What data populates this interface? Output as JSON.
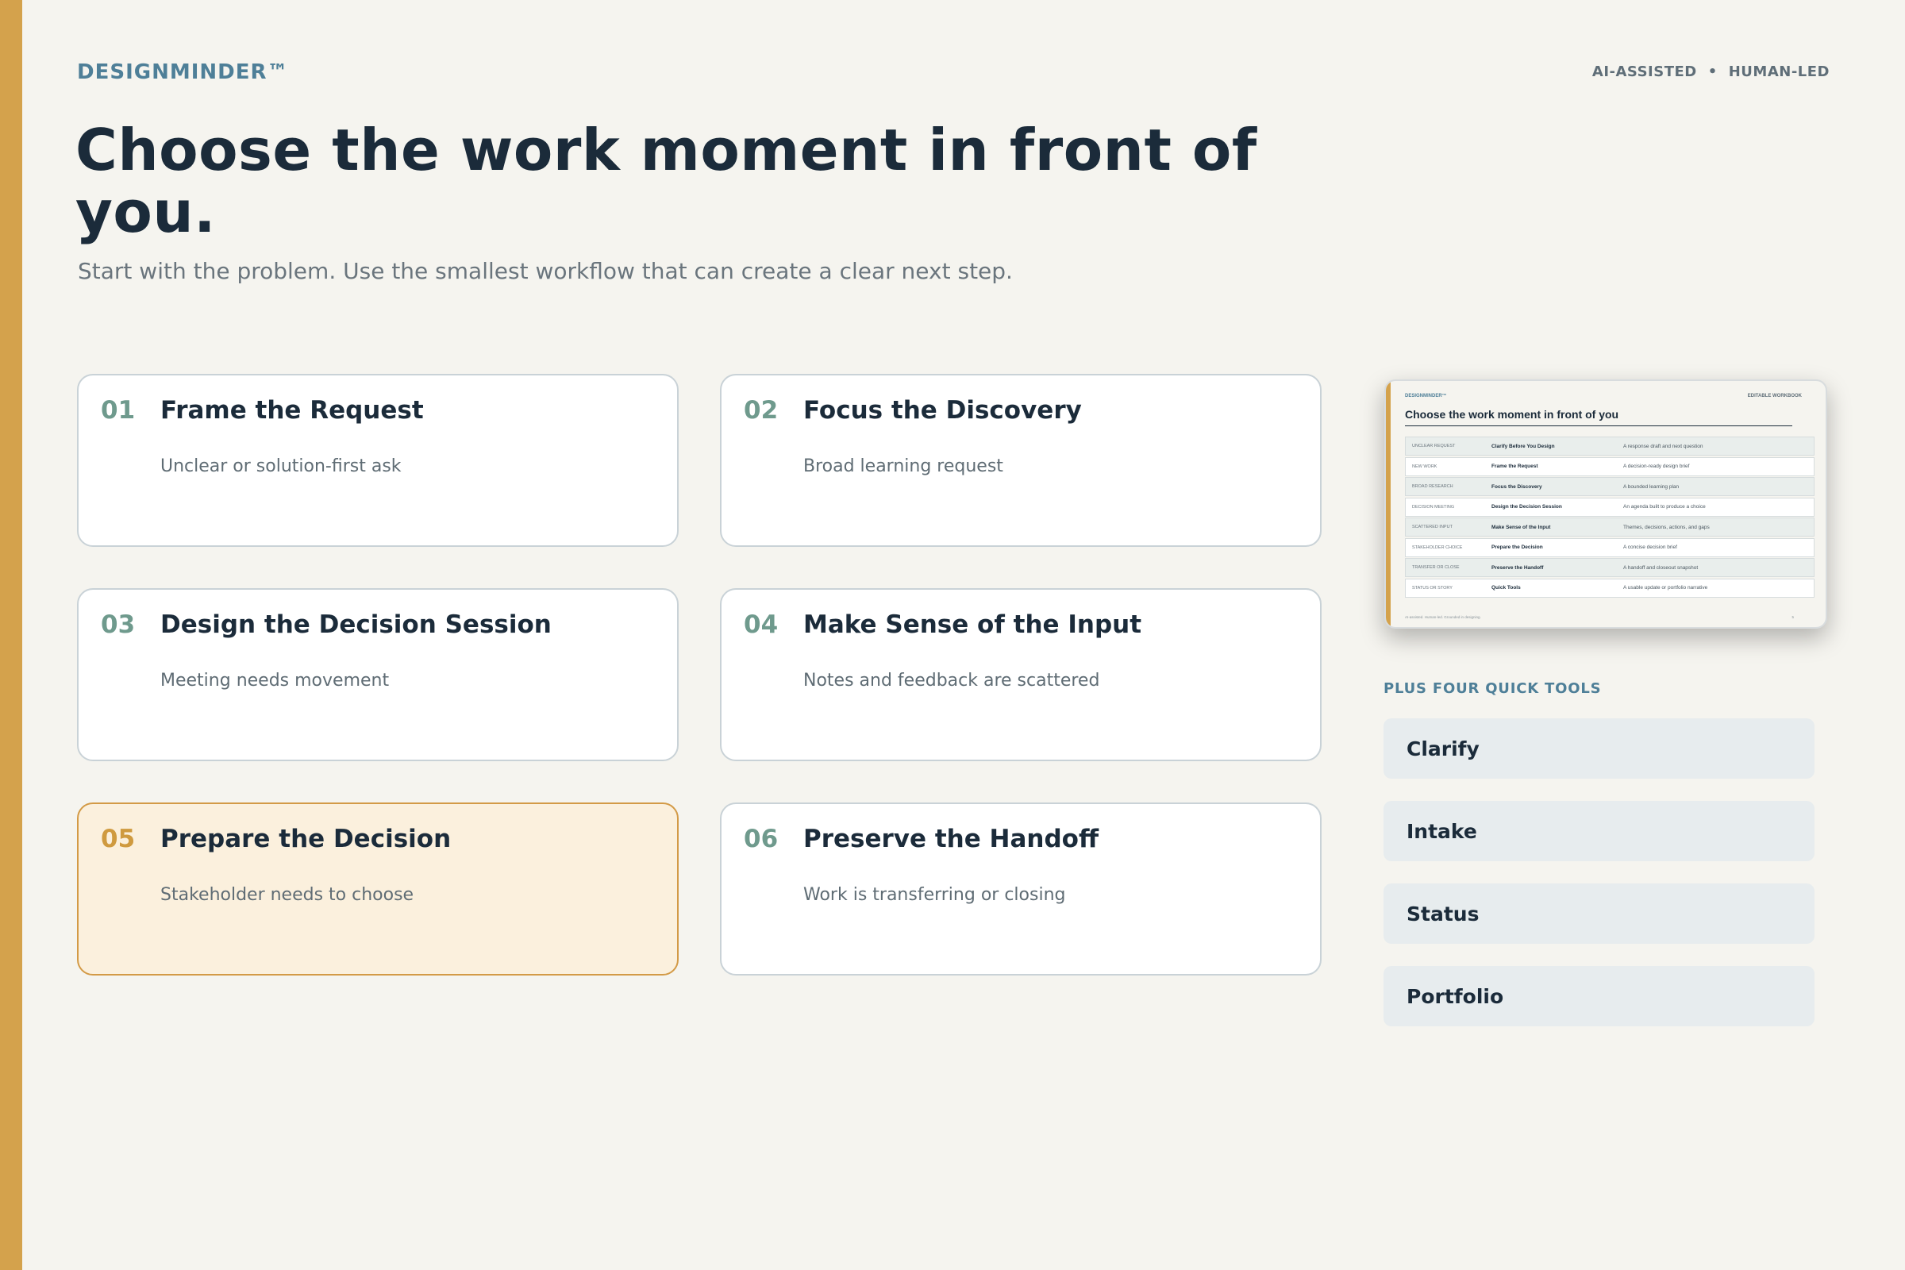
{
  "brand": "DESIGNMINDER™",
  "tagline": {
    "left": "AI-ASSISTED",
    "separator": "•",
    "right": "HUMAN-LED"
  },
  "title": "Choose the work moment in front of you.",
  "subtitle": "Start with the problem. Use the smallest workflow that can create a clear next step.",
  "cards": [
    {
      "num": "01",
      "title": "Frame the Request",
      "desc": "Unclear or solution-first ask",
      "selected": false
    },
    {
      "num": "02",
      "title": "Focus the Discovery",
      "desc": "Broad learning request",
      "selected": false
    },
    {
      "num": "03",
      "title": "Design the Decision Session",
      "desc": "Meeting needs movement",
      "selected": false
    },
    {
      "num": "04",
      "title": "Make Sense of the Input",
      "desc": "Notes and feedback are scattered",
      "selected": false
    },
    {
      "num": "05",
      "title": "Prepare the Decision",
      "desc": "Stakeholder needs to choose",
      "selected": true
    },
    {
      "num": "06",
      "title": "Preserve the Handoff",
      "desc": "Work is transferring or closing",
      "selected": false
    }
  ],
  "preview": {
    "brand": "DESIGNMINDER™",
    "tag": "EDITABLE WORKBOOK",
    "title": "Choose the work moment in front of you",
    "rows": [
      {
        "moment": "UNCLEAR REQUEST",
        "workflow": "Clarify Before You Design",
        "output": "A response draft and next question"
      },
      {
        "moment": "NEW WORK",
        "workflow": "Frame the Request",
        "output": "A decision-ready design brief"
      },
      {
        "moment": "BROAD RESEARCH",
        "workflow": "Focus the Discovery",
        "output": "A bounded learning plan"
      },
      {
        "moment": "DECISION MEETING",
        "workflow": "Design the Decision Session",
        "output": "An agenda built to produce a choice"
      },
      {
        "moment": "SCATTERED INPUT",
        "workflow": "Make Sense of the Input",
        "output": "Themes, decisions, actions, and gaps"
      },
      {
        "moment": "STAKEHOLDER CHOICE",
        "workflow": "Prepare the Decision",
        "output": "A concise decision brief"
      },
      {
        "moment": "TRANSFER OR CLOSE",
        "workflow": "Preserve the Handoff",
        "output": "A handoff and closeout snapshot"
      },
      {
        "moment": "STATUS OR STORY",
        "workflow": "Quick Tools",
        "output": "A usable update or portfolio narrative"
      }
    ],
    "footer": "AI-assisted. Human-led. Grounded in designing.",
    "page": "5"
  },
  "tools_heading": "PLUS FOUR QUICK TOOLS",
  "tools": [
    "Clarify",
    "Intake",
    "Status",
    "Portfolio"
  ],
  "colors": {
    "accent": "#d4a24c",
    "brand": "#4e7f98",
    "selected_bg": "#fbf0dd",
    "selected_border": "#d39a46"
  }
}
